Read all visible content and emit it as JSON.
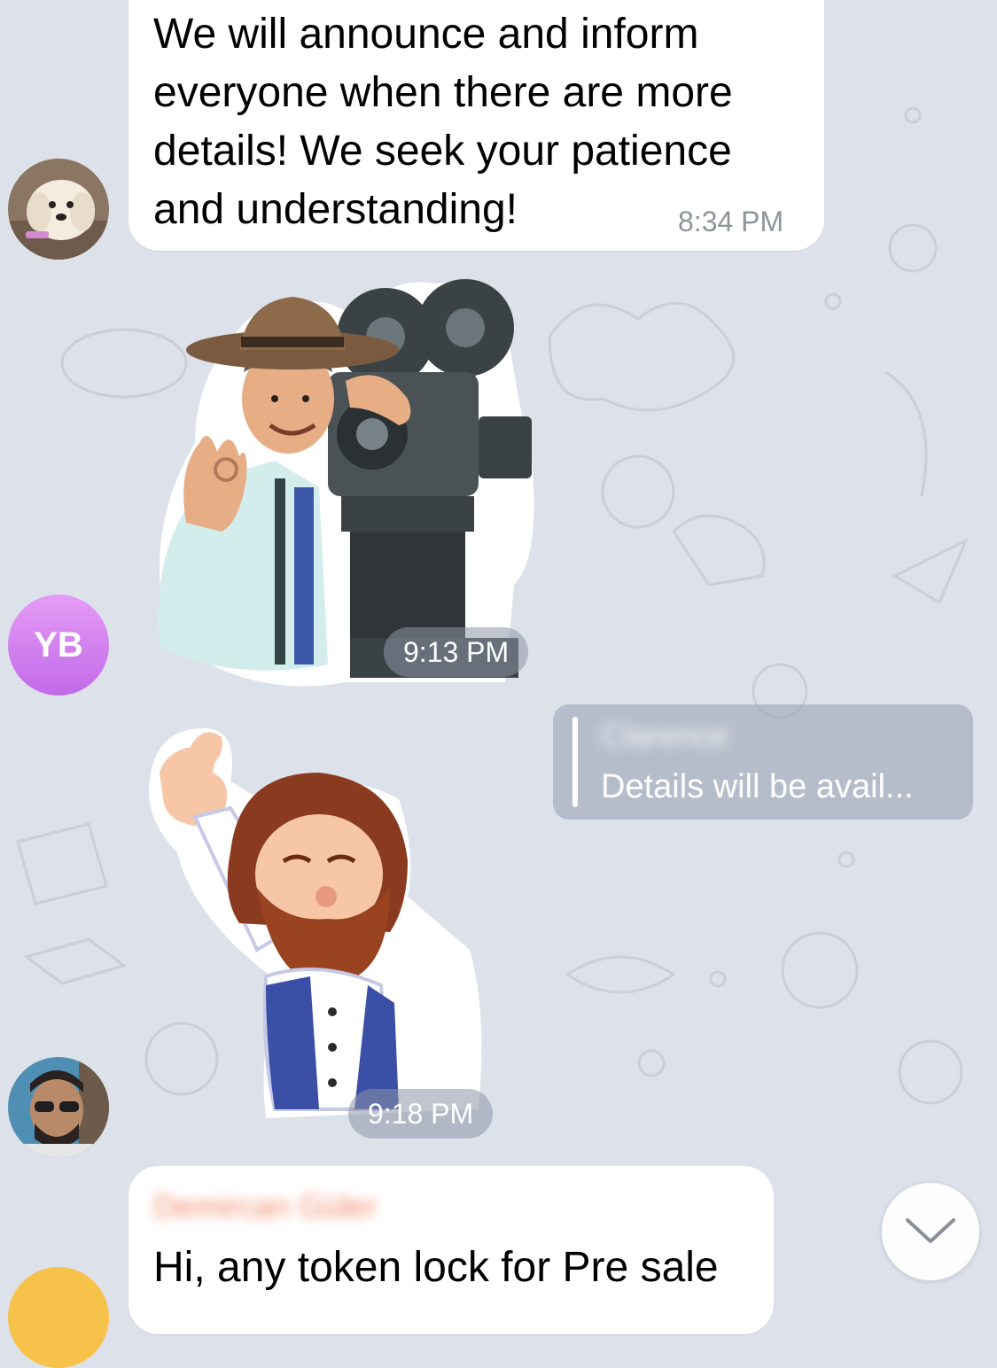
{
  "messages": [
    {
      "text": "We will announce and inform everyone when there are more details! We seek your patience and understanding!",
      "lines": [
        "We will announce and inform",
        "everyone when there are more",
        "details! We seek your patience",
        "and understanding!"
      ],
      "time": "8:34 PM"
    },
    {
      "sender_initials": "YB",
      "time": "9:13 PM",
      "sticker": "director-camera-sticker"
    },
    {
      "reply": {
        "name": "Clarence",
        "text": "Details will be avail..."
      },
      "time": "9:18 PM",
      "sticker": "thumbs-up-bearded-man-sticker"
    },
    {
      "sender_name": "Demircan Güler",
      "text": "Hi, any token lock for Pre sale"
    }
  ],
  "colors": {
    "wallpaper": "#dde1ea",
    "accent_avatar": "#c16ae8",
    "name_accent": "#f08a6a"
  },
  "icons": {
    "scroll_down": "chevron-down-icon"
  }
}
